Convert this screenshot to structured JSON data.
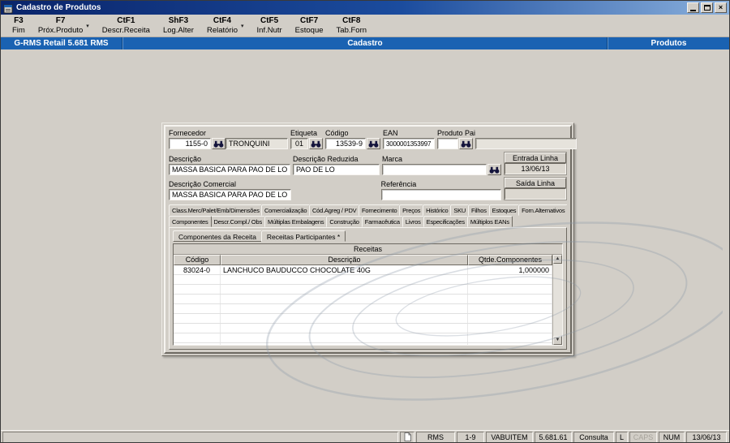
{
  "window": {
    "title": "Cadastro de Produtos"
  },
  "icons": {
    "dropdown": "▾",
    "window_close": "×",
    "scroll_up": "▲",
    "scroll_down": "▼"
  },
  "toolbar": {
    "buttons": [
      {
        "key": "F3",
        "label": "Fim"
      },
      {
        "key": "F7",
        "label": "Próx.Produto"
      },
      {
        "key": "CtF1",
        "label": "Descr.Receita"
      },
      {
        "key": "ShF3",
        "label": "Log.Alter"
      },
      {
        "key": "CtF4",
        "label": "Relatório"
      },
      {
        "key": "CtF5",
        "label": "Inf.Nutr"
      },
      {
        "key": "CtF7",
        "label": "Estoque"
      },
      {
        "key": "CtF8",
        "label": "Tab.Forn"
      }
    ]
  },
  "header_bar": {
    "left": "G-RMS Retail 5.681 RMS",
    "center": "Cadastro",
    "right": "Produtos"
  },
  "form": {
    "fornecedor": {
      "label": "Fornecedor",
      "code": "1155-0",
      "name": "TRONQUINI"
    },
    "etiqueta": {
      "label": "Etiqueta",
      "value": "01"
    },
    "codigo": {
      "label": "Código",
      "value": "13539-9"
    },
    "ean": {
      "label": "EAN",
      "value": "3000001353997"
    },
    "produto_pai": {
      "label": "Produto Pai",
      "code": "",
      "name": ""
    },
    "descricao": {
      "label": "Descrição",
      "value": "MASSA BASICA PARA PAO DE LO"
    },
    "descricao_reduzida": {
      "label": "Descrição Reduzida",
      "value": "PAO DE LO"
    },
    "marca": {
      "label": "Marca",
      "value": ""
    },
    "descricao_comercial": {
      "label": "Descrição Comercial",
      "value": "MASSA BASICA PARA PAO DE LO"
    },
    "referencia": {
      "label": "Referência",
      "value": ""
    },
    "entrada_linha": {
      "label": "Entrada Linha",
      "value": "13/06/13"
    },
    "saida_linha": {
      "label": "Saída Linha",
      "value": ""
    }
  },
  "tabs": {
    "row1": [
      "Class.Merc/Palet/Emb/Dimensões",
      "Comercialização",
      "Cód.Agreg / PDV",
      "Fornecimento",
      "Preços",
      "Histórico",
      "SKU",
      "Filhos",
      "Estoques",
      "Forn.Alternativos"
    ],
    "row2": [
      "Componentes",
      "Descr.Compl./ Obs",
      "Múltiplas Embalagens",
      "Construção",
      "Farmacêutica",
      "Livros",
      "Especificações",
      "Múltiplos EANs"
    ],
    "inner": [
      "Componentes da Receita",
      "Receitas Participantes *"
    ]
  },
  "recipes_table": {
    "group_header": "Receitas",
    "columns": [
      "Código",
      "Descrição",
      "Qtde.Componentes"
    ],
    "rows": [
      {
        "codigo": "83024-0",
        "descricao": "LANCHUCO BAUDUCCO CHOCOLATE 40G",
        "qtde": "1,000000"
      }
    ]
  },
  "status_bar": {
    "items": [
      "RMS",
      "1-9",
      "VABUITEM",
      "5.681.61",
      "Consulta",
      "L",
      "CAPS",
      "NUM",
      "13/06/13"
    ]
  }
}
